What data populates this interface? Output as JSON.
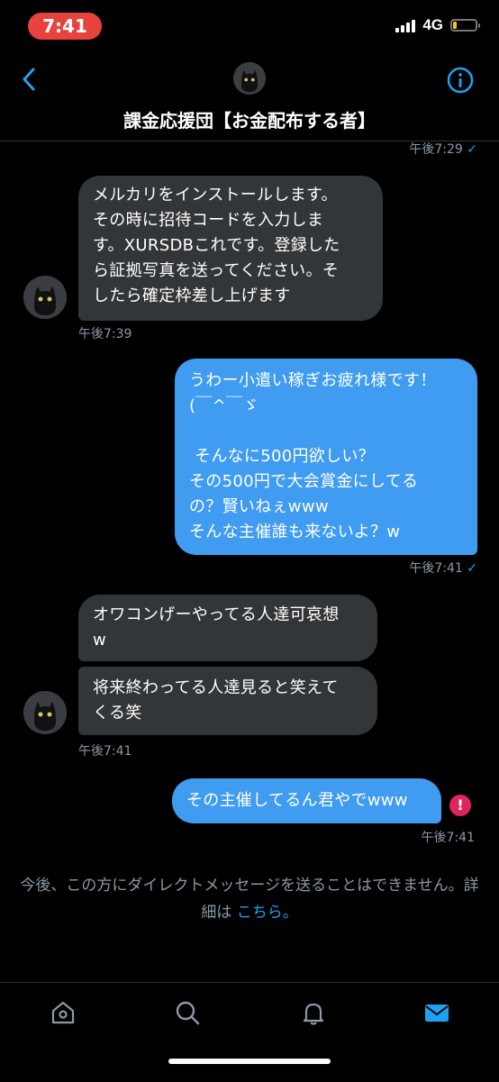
{
  "status": {
    "time": "7:41",
    "network": "4G"
  },
  "header": {
    "title": "課金応援団【お金配布する者】"
  },
  "messages": [
    {
      "ts": "午後7:29",
      "check": "✓"
    },
    {
      "text": "メルカリをインストールします。\nその時に招待コードを入力しま\nす。XURSDBこれです。登録した\nら証拠写真を送ってください。そ\nしたら確定枠差し上げます",
      "ts": "午後7:39"
    },
    {
      "text": "うわー小遣い稼ぎお疲れ様です！\n(￣^￣ゞ\n\n そんなに500円欲しい？\nその500円で大会賞金にしてる\nの？賢いねぇwww\nそんな主催誰も来ないよ？w",
      "ts": "午後7:41",
      "check": "✓"
    },
    {
      "text": "オワコンげーやってる人達可哀想\nw"
    },
    {
      "text": "将来終わってる人達見ると笑えて\nくる笑",
      "ts": "午後7:41"
    },
    {
      "text": "その主催してるん君やでwww",
      "ts": "午後7:41",
      "error": "!"
    }
  ],
  "notice": {
    "text": "今後、この方にダイレクトメッセージを送ることはできません。詳細は ",
    "link": "こちら",
    "end": "。"
  },
  "tabs": [
    {
      "icon": "home-icon"
    },
    {
      "icon": "search-icon"
    },
    {
      "icon": "bell-icon"
    },
    {
      "icon": "mail-icon",
      "active": true
    }
  ],
  "colors": {
    "accent": "#1da1f2",
    "outgoing": "#3f9cf0",
    "incoming": "#333639",
    "error": "#e0245e"
  }
}
